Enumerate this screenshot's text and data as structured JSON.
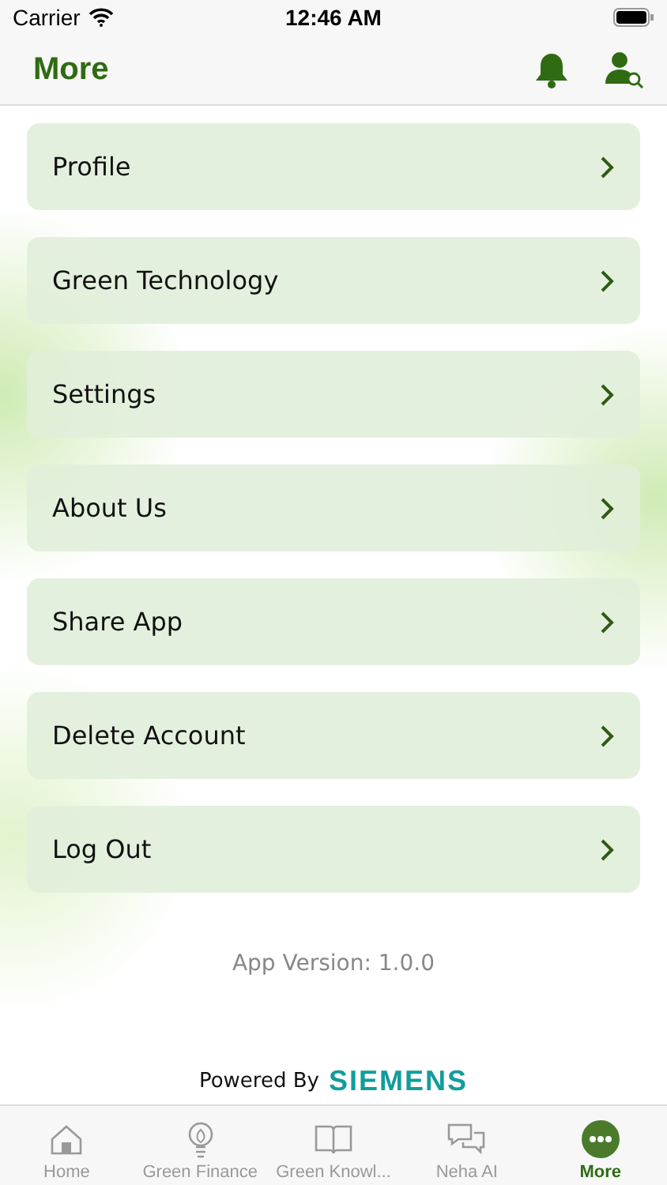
{
  "status_bar": {
    "carrier": "Carrier",
    "time": "12:46 AM"
  },
  "header": {
    "title": "More"
  },
  "menu_items": [
    {
      "label": "Profile"
    },
    {
      "label": "Green Technology"
    },
    {
      "label": "Settings"
    },
    {
      "label": "About Us"
    },
    {
      "label": "Share App"
    },
    {
      "label": "Delete Account"
    },
    {
      "label": "Log Out"
    }
  ],
  "version": "App Version: 1.0.0",
  "powered_by": {
    "label": "Powered By",
    "brand": "SIEMENS"
  },
  "tabs": [
    {
      "kind": "home",
      "label": "Home",
      "selected": false
    },
    {
      "kind": "bulb",
      "label": "Green Finance",
      "selected": false
    },
    {
      "kind": "book",
      "label": "Green Knowl...",
      "selected": false
    },
    {
      "kind": "chat",
      "label": "Neha AI",
      "selected": false
    },
    {
      "kind": "more",
      "label": "More",
      "selected": true
    }
  ]
}
